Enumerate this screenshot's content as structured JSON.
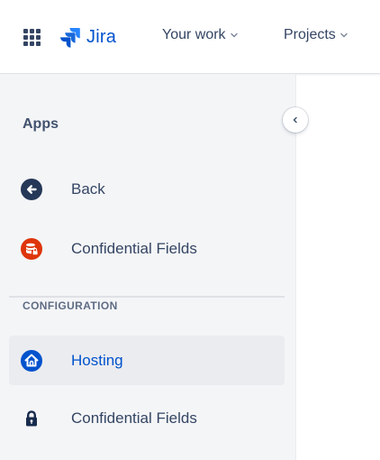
{
  "topnav": {
    "app_switcher_icon": "grid-icon",
    "logo_icon": "jira-logo-icon",
    "logo_text": "Jira",
    "your_work_label": "Your work",
    "projects_label": "Projects",
    "chevron_icon": "chevron-down-icon"
  },
  "sidebar": {
    "title": "Apps",
    "collapse_icon": "chevron-left-icon",
    "back": {
      "label": "Back",
      "icon": "arrow-left-circle-icon"
    },
    "confidential_app": {
      "label": "Confidential Fields",
      "icon": "database-lock-icon"
    },
    "section_heading": "CONFIGURATION",
    "hosting": {
      "label": "Hosting",
      "icon": "home-icon",
      "selected": true
    },
    "confidential_config": {
      "label": "Confidential Fields",
      "icon": "lock-icon"
    }
  },
  "colors": {
    "brand_blue": "#0052cc",
    "dark_icon": "#253858",
    "red_icon": "#de350b",
    "sidebar_bg": "#f4f5f7",
    "selected_bg": "#ebecf0"
  }
}
